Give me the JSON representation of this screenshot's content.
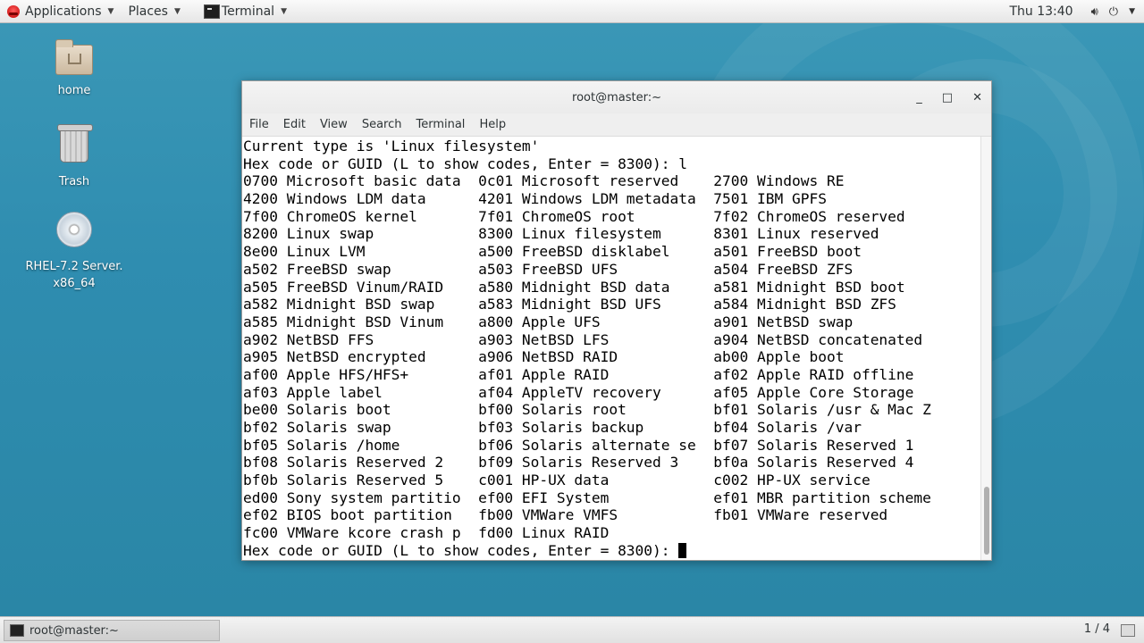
{
  "topbar": {
    "applications": "Applications",
    "places": "Places",
    "terminal": "Terminal",
    "clock": "Thu 13:40"
  },
  "desktop_icons": [
    {
      "label": "home"
    },
    {
      "label": "Trash"
    },
    {
      "label_line1": "RHEL-7.2 Server.",
      "label_line2": "x86_64"
    }
  ],
  "window": {
    "title": "root@master:~",
    "menu": [
      "File",
      "Edit",
      "View",
      "Search",
      "Terminal",
      "Help"
    ],
    "minimize": "_",
    "maximize": "□",
    "close": "✕"
  },
  "terminal": {
    "lines": [
      "Current type is 'Linux filesystem'",
      "Hex code or GUID (L to show codes, Enter = 8300): l",
      "0700 Microsoft basic data  0c01 Microsoft reserved    2700 Windows RE",
      "4200 Windows LDM data      4201 Windows LDM metadata  7501 IBM GPFS",
      "7f00 ChromeOS kernel       7f01 ChromeOS root         7f02 ChromeOS reserved",
      "8200 Linux swap            8300 Linux filesystem      8301 Linux reserved",
      "8e00 Linux LVM             a500 FreeBSD disklabel     a501 FreeBSD boot",
      "a502 FreeBSD swap          a503 FreeBSD UFS           a504 FreeBSD ZFS",
      "a505 FreeBSD Vinum/RAID    a580 Midnight BSD data     a581 Midnight BSD boot",
      "a582 Midnight BSD swap     a583 Midnight BSD UFS      a584 Midnight BSD ZFS",
      "a585 Midnight BSD Vinum    a800 Apple UFS             a901 NetBSD swap",
      "a902 NetBSD FFS            a903 NetBSD LFS            a904 NetBSD concatenated",
      "a905 NetBSD encrypted      a906 NetBSD RAID           ab00 Apple boot",
      "af00 Apple HFS/HFS+        af01 Apple RAID            af02 Apple RAID offline",
      "af03 Apple label           af04 AppleTV recovery      af05 Apple Core Storage",
      "be00 Solaris boot          bf00 Solaris root          bf01 Solaris /usr & Mac Z",
      "bf02 Solaris swap          bf03 Solaris backup        bf04 Solaris /var",
      "bf05 Solaris /home         bf06 Solaris alternate se  bf07 Solaris Reserved 1",
      "bf08 Solaris Reserved 2    bf09 Solaris Reserved 3    bf0a Solaris Reserved 4",
      "bf0b Solaris Reserved 5    c001 HP-UX data            c002 HP-UX service",
      "ed00 Sony system partitio  ef00 EFI System            ef01 MBR partition scheme",
      "ef02 BIOS boot partition   fb00 VMWare VMFS           fb01 VMWare reserved",
      "fc00 VMWare kcore crash p  fd00 Linux RAID"
    ],
    "prompt": "Hex code or GUID (L to show codes, Enter = 8300): "
  },
  "bottombar": {
    "task_label": "root@master:~",
    "workspace": "1 / 4"
  }
}
